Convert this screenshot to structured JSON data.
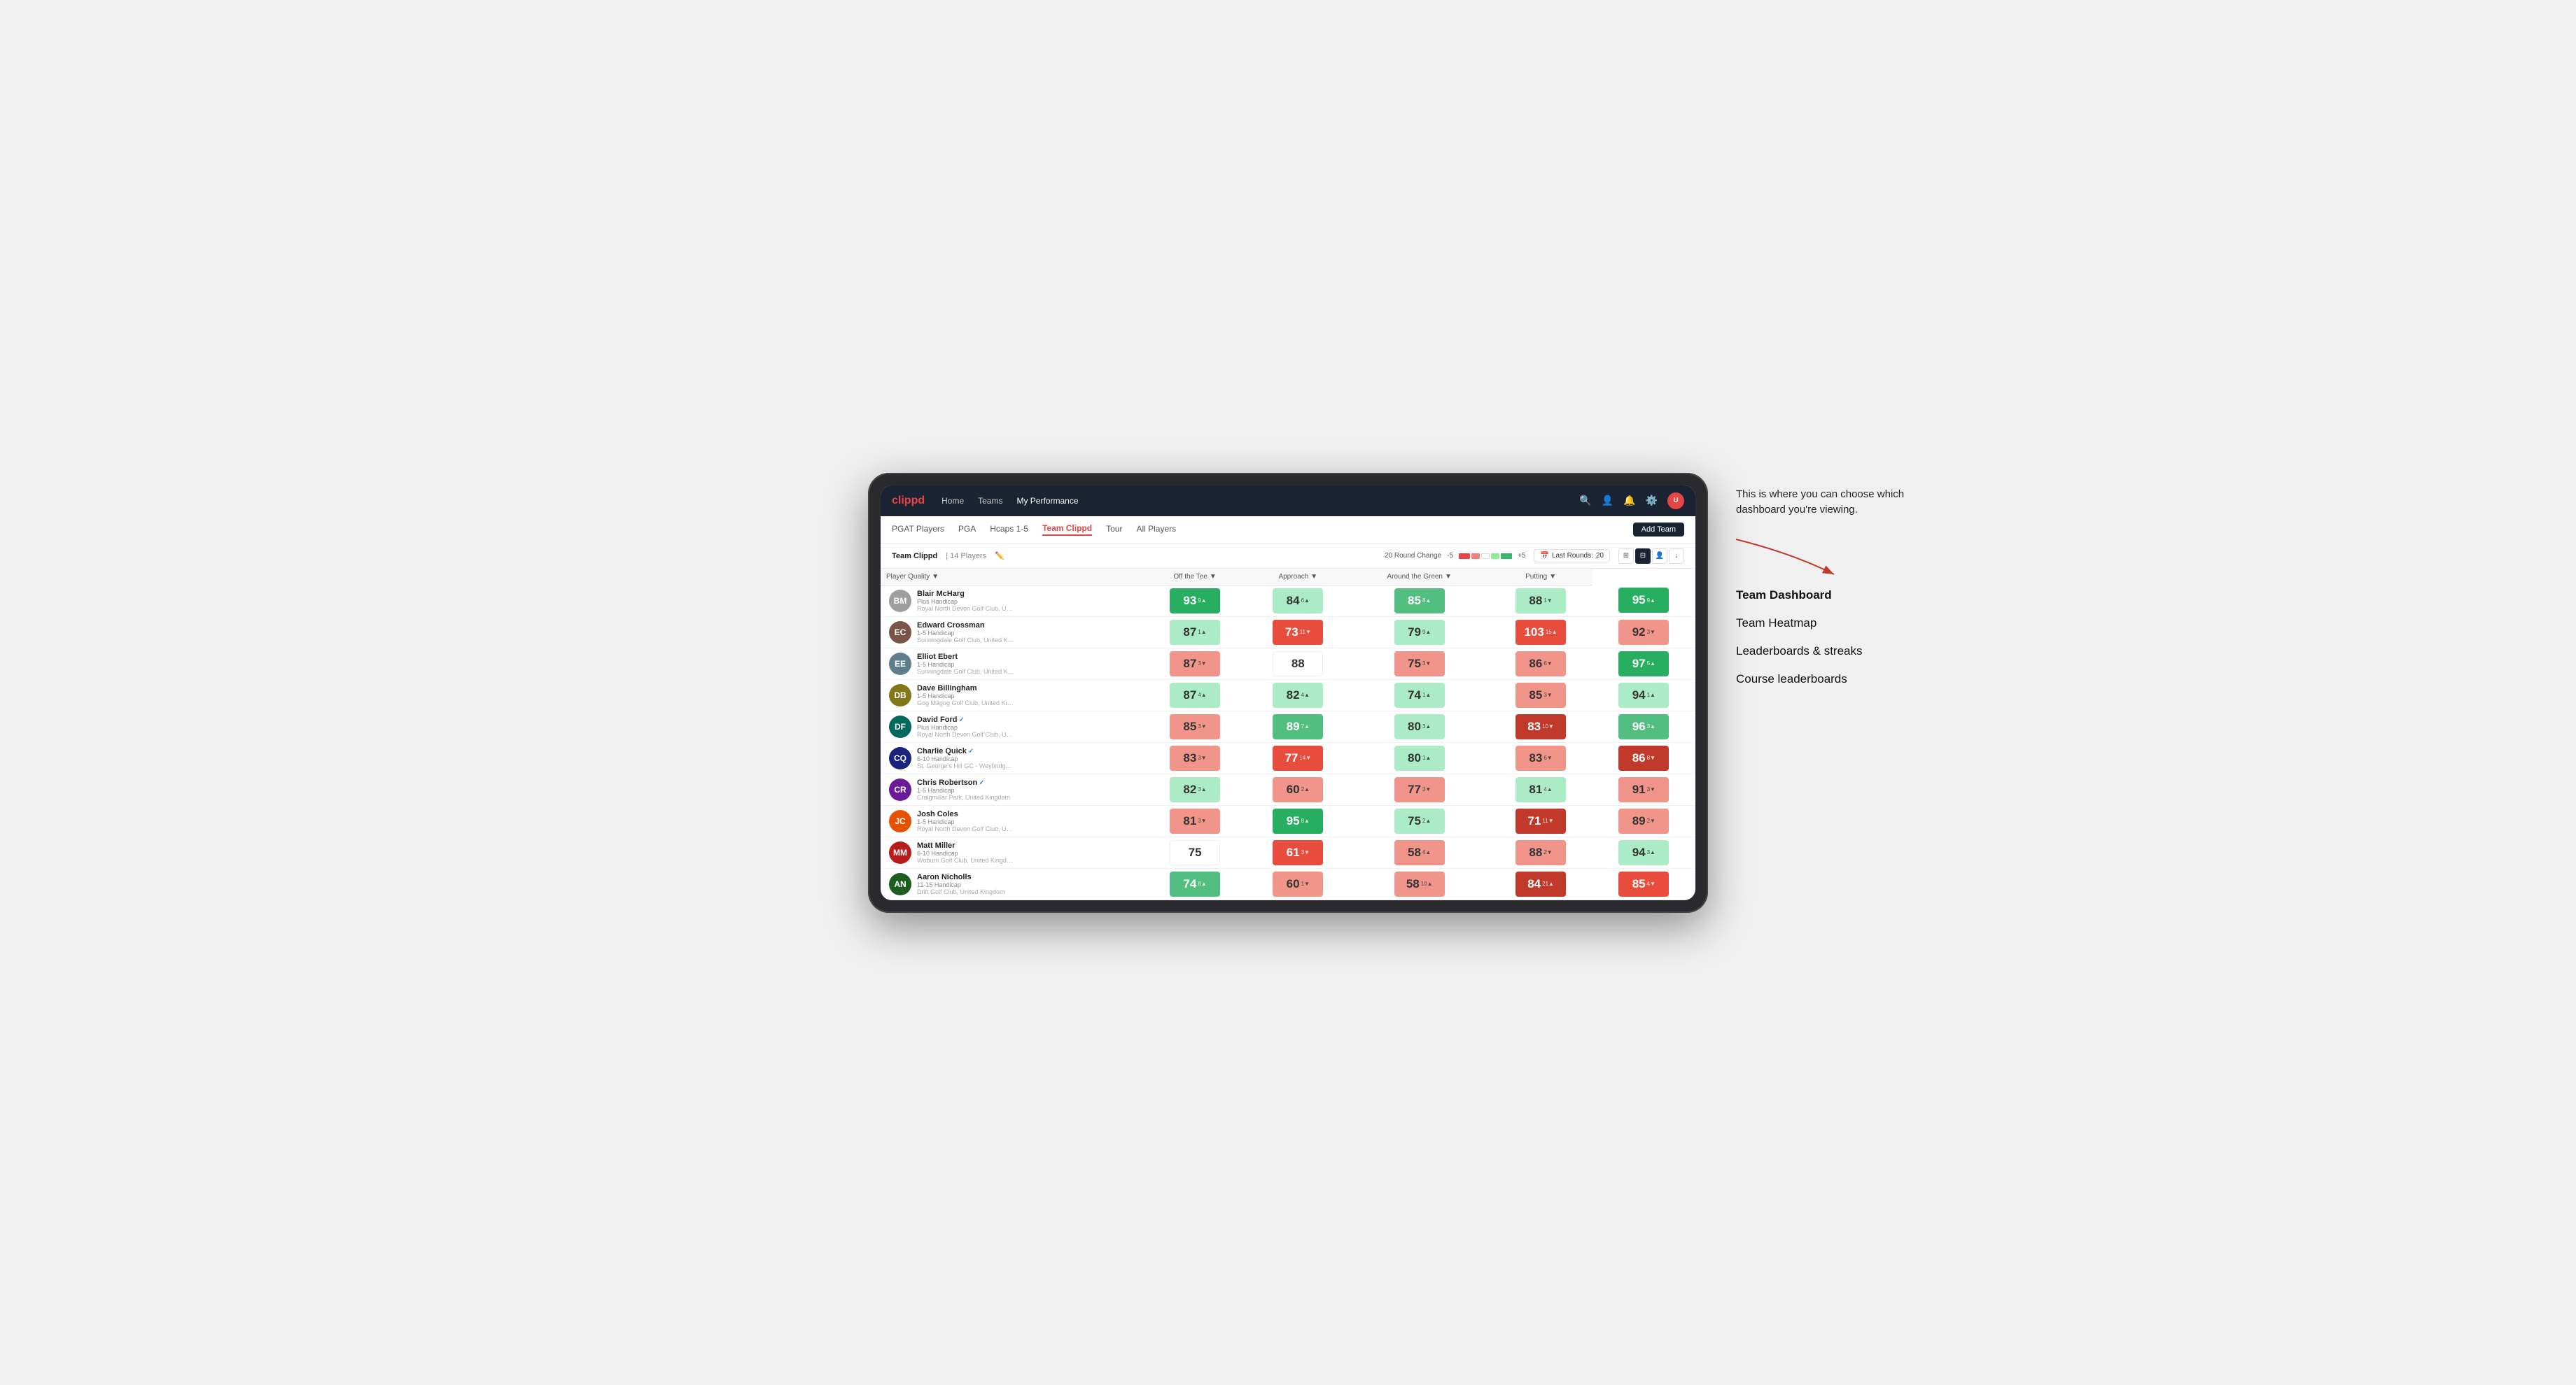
{
  "annotation": {
    "intro": "This is where you can choose which dashboard you're viewing.",
    "menu_items": [
      {
        "label": "Team Dashboard",
        "active": true
      },
      {
        "label": "Team Heatmap",
        "active": false
      },
      {
        "label": "Leaderboards & streaks",
        "active": false
      },
      {
        "label": "Course leaderboards",
        "active": false
      }
    ]
  },
  "nav": {
    "logo": "clippd",
    "links": [
      {
        "label": "Home",
        "active": false
      },
      {
        "label": "Teams",
        "active": false
      },
      {
        "label": "My Performance",
        "active": true
      }
    ]
  },
  "sub_nav": {
    "links": [
      {
        "label": "PGAT Players",
        "active": false
      },
      {
        "label": "PGA",
        "active": false
      },
      {
        "label": "Hcaps 1-5",
        "active": false
      },
      {
        "label": "Team Clippd",
        "active": true
      },
      {
        "label": "Tour",
        "active": false
      },
      {
        "label": "All Players",
        "active": false
      }
    ],
    "add_team_label": "Add Team"
  },
  "team_bar": {
    "name": "Team Clippd",
    "separator": "|",
    "count": "14 Players",
    "round_change_label": "20 Round Change",
    "range_low": "-5",
    "range_high": "+5",
    "last_rounds_label": "Last Rounds:",
    "last_rounds_count": "20"
  },
  "table": {
    "headers": {
      "player": "Player Quality",
      "off_tee": "Off the Tee",
      "approach": "Approach",
      "around_green": "Around the Green",
      "putting": "Putting"
    },
    "rows": [
      {
        "name": "Blair McHarg",
        "handicap": "Plus Handicap",
        "club": "Royal North Devon Golf Club, United Kingdom",
        "initials": "BM",
        "av_color": "av-gray",
        "scores": [
          {
            "value": "93",
            "change": "9",
            "dir": "up",
            "color": "green-dark"
          },
          {
            "value": "84",
            "change": "6",
            "dir": "up",
            "color": "green-light"
          },
          {
            "value": "85",
            "change": "8",
            "dir": "up",
            "color": "green-mid"
          },
          {
            "value": "88",
            "change": "1",
            "dir": "down",
            "color": "green-light"
          },
          {
            "value": "95",
            "change": "9",
            "dir": "up",
            "color": "green-dark"
          }
        ]
      },
      {
        "name": "Edward Crossman",
        "handicap": "1-5 Handicap",
        "club": "Sunningdale Golf Club, United Kingdom",
        "initials": "EC",
        "av_color": "av-brown",
        "scores": [
          {
            "value": "87",
            "change": "1",
            "dir": "up",
            "color": "green-light"
          },
          {
            "value": "73",
            "change": "11",
            "dir": "down",
            "color": "red-mid"
          },
          {
            "value": "79",
            "change": "9",
            "dir": "up",
            "color": "green-light"
          },
          {
            "value": "103",
            "change": "15",
            "dir": "up",
            "color": "red-mid"
          },
          {
            "value": "92",
            "change": "3",
            "dir": "down",
            "color": "red-light"
          }
        ]
      },
      {
        "name": "Elliot Ebert",
        "handicap": "1-5 Handicap",
        "club": "Sunningdale Golf Club, United Kingdom",
        "initials": "EE",
        "av_color": "av-darkgray",
        "scores": [
          {
            "value": "87",
            "change": "3",
            "dir": "down",
            "color": "red-light"
          },
          {
            "value": "88",
            "change": "",
            "dir": "",
            "color": "white"
          },
          {
            "value": "75",
            "change": "3",
            "dir": "down",
            "color": "red-light"
          },
          {
            "value": "86",
            "change": "6",
            "dir": "down",
            "color": "red-light"
          },
          {
            "value": "97",
            "change": "5",
            "dir": "up",
            "color": "green-dark"
          }
        ]
      },
      {
        "name": "Dave Billingham",
        "handicap": "1-5 Handicap",
        "club": "Gog Magog Golf Club, United Kingdom",
        "initials": "DB",
        "av_color": "av-olive",
        "scores": [
          {
            "value": "87",
            "change": "4",
            "dir": "up",
            "color": "green-light"
          },
          {
            "value": "82",
            "change": "4",
            "dir": "up",
            "color": "green-light"
          },
          {
            "value": "74",
            "change": "1",
            "dir": "up",
            "color": "green-light"
          },
          {
            "value": "85",
            "change": "3",
            "dir": "down",
            "color": "red-light"
          },
          {
            "value": "94",
            "change": "1",
            "dir": "up",
            "color": "green-light"
          }
        ]
      },
      {
        "name": "David Ford",
        "handicap": "Plus Handicap",
        "club": "Royal North Devon Golf Club, United Kingdom",
        "initials": "DF",
        "av_color": "av-teal",
        "verified": true,
        "scores": [
          {
            "value": "85",
            "change": "3",
            "dir": "down",
            "color": "red-light"
          },
          {
            "value": "89",
            "change": "7",
            "dir": "up",
            "color": "green-mid"
          },
          {
            "value": "80",
            "change": "3",
            "dir": "up",
            "color": "green-light"
          },
          {
            "value": "83",
            "change": "10",
            "dir": "down",
            "color": "red-dark"
          },
          {
            "value": "96",
            "change": "3",
            "dir": "up",
            "color": "green-mid"
          }
        ]
      },
      {
        "name": "Charlie Quick",
        "handicap": "6-10 Handicap",
        "club": "St. George's Hill GC - Weybridge - Surrey, Uni...",
        "initials": "CQ",
        "av_color": "av-navy",
        "verified": true,
        "scores": [
          {
            "value": "83",
            "change": "3",
            "dir": "down",
            "color": "red-light"
          },
          {
            "value": "77",
            "change": "14",
            "dir": "down",
            "color": "red-mid"
          },
          {
            "value": "80",
            "change": "1",
            "dir": "up",
            "color": "green-light"
          },
          {
            "value": "83",
            "change": "6",
            "dir": "down",
            "color": "red-light"
          },
          {
            "value": "86",
            "change": "8",
            "dir": "down",
            "color": "red-dark"
          }
        ]
      },
      {
        "name": "Chris Robertson",
        "handicap": "1-5 Handicap",
        "club": "Craigmillar Park, United Kingdom",
        "initials": "CR",
        "av_color": "av-purple",
        "verified": true,
        "scores": [
          {
            "value": "82",
            "change": "3",
            "dir": "up",
            "color": "green-light"
          },
          {
            "value": "60",
            "change": "2",
            "dir": "up",
            "color": "red-light"
          },
          {
            "value": "77",
            "change": "3",
            "dir": "down",
            "color": "red-light"
          },
          {
            "value": "81",
            "change": "4",
            "dir": "up",
            "color": "green-light"
          },
          {
            "value": "91",
            "change": "3",
            "dir": "down",
            "color": "red-light"
          }
        ]
      },
      {
        "name": "Josh Coles",
        "handicap": "1-5 Handicap",
        "club": "Royal North Devon Golf Club, United Kingdom",
        "initials": "JC",
        "av_color": "av-orange",
        "scores": [
          {
            "value": "81",
            "change": "3",
            "dir": "down",
            "color": "red-light"
          },
          {
            "value": "95",
            "change": "8",
            "dir": "up",
            "color": "green-dark"
          },
          {
            "value": "75",
            "change": "2",
            "dir": "up",
            "color": "green-light"
          },
          {
            "value": "71",
            "change": "11",
            "dir": "down",
            "color": "red-dark"
          },
          {
            "value": "89",
            "change": "2",
            "dir": "down",
            "color": "red-light"
          }
        ]
      },
      {
        "name": "Matt Miller",
        "handicap": "6-10 Handicap",
        "club": "Woburn Golf Club, United Kingdom",
        "initials": "MM",
        "av_color": "av-red",
        "scores": [
          {
            "value": "75",
            "change": "",
            "dir": "",
            "color": "white"
          },
          {
            "value": "61",
            "change": "3",
            "dir": "down",
            "color": "red-mid"
          },
          {
            "value": "58",
            "change": "4",
            "dir": "up",
            "color": "red-light"
          },
          {
            "value": "88",
            "change": "2",
            "dir": "down",
            "color": "red-light"
          },
          {
            "value": "94",
            "change": "3",
            "dir": "up",
            "color": "green-light"
          }
        ]
      },
      {
        "name": "Aaron Nicholls",
        "handicap": "11-15 Handicap",
        "club": "Drift Golf Club, United Kingdom",
        "initials": "AN",
        "av_color": "av-green",
        "scores": [
          {
            "value": "74",
            "change": "8",
            "dir": "up",
            "color": "green-mid"
          },
          {
            "value": "60",
            "change": "1",
            "dir": "down",
            "color": "red-light"
          },
          {
            "value": "58",
            "change": "10",
            "dir": "up",
            "color": "red-light"
          },
          {
            "value": "84",
            "change": "21",
            "dir": "up",
            "color": "red-dark"
          },
          {
            "value": "85",
            "change": "4",
            "dir": "down",
            "color": "red-mid"
          }
        ]
      }
    ]
  }
}
